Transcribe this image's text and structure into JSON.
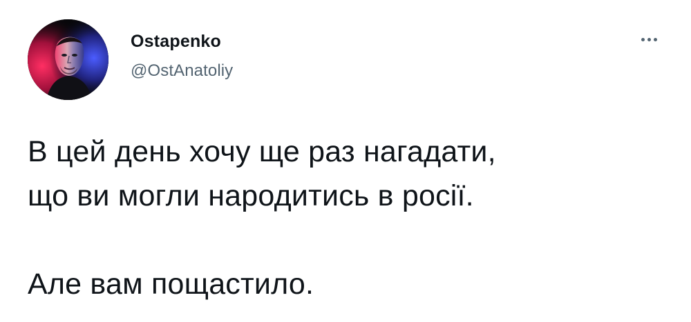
{
  "author": {
    "display_name": "Ostapenko",
    "handle": "@OstAnatoliy",
    "avatar_icon": "profile-photo"
  },
  "more_icon": "more-horizontal-icon",
  "tweet": {
    "paragraphs": [
      [
        "В цей день хочу ще раз нагадати,",
        "що ви могли народитись в росії."
      ],
      [
        "Але вам пощастило."
      ]
    ]
  },
  "colors": {
    "text": "#0f1419",
    "secondary_text": "#536471",
    "background": "#ffffff",
    "avatar_background": "#07070a"
  }
}
